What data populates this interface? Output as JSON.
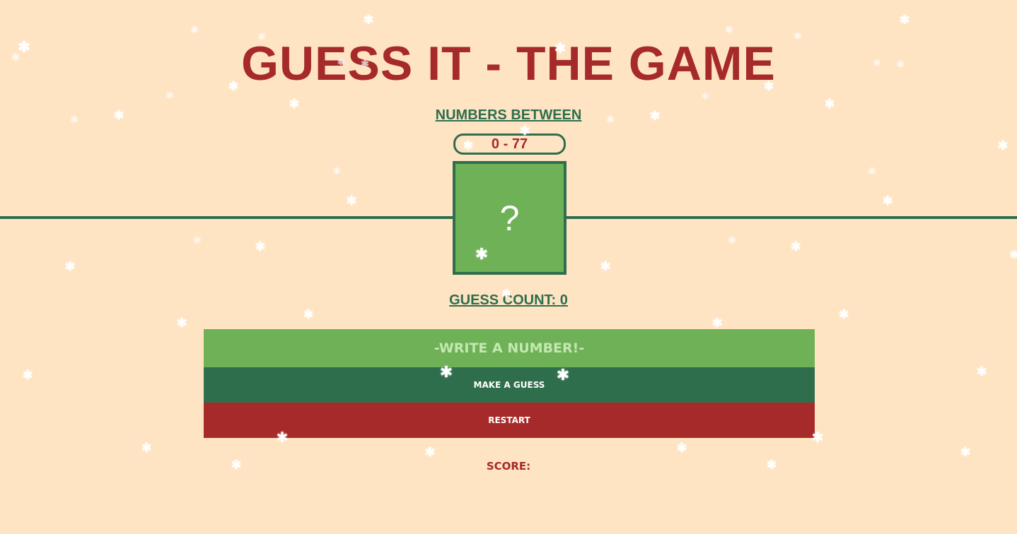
{
  "header": {
    "title": "GUESS IT - THE GAME",
    "subtitle": "NUMBERS BETWEEN",
    "range": "0 - 77"
  },
  "board": {
    "secret_placeholder": "?",
    "guess_count": "GUESS COUNT: 0"
  },
  "controls": {
    "input_placeholder": "-WRITE A NUMBER!-",
    "input_value": "",
    "guess_button": "MAKE A GUESS",
    "restart_button": "RESTART"
  },
  "footer": {
    "score_label": "SCORE:"
  },
  "decor": {
    "snowflake_icon": "snowflake-icon",
    "snowflake_glyph": "✱"
  },
  "colors": {
    "background": "#ffe4c4",
    "title_red": "#a62a2a",
    "dark_green": "#2e6e4c",
    "light_green": "#6fb157",
    "button_text": "#ffffff"
  }
}
